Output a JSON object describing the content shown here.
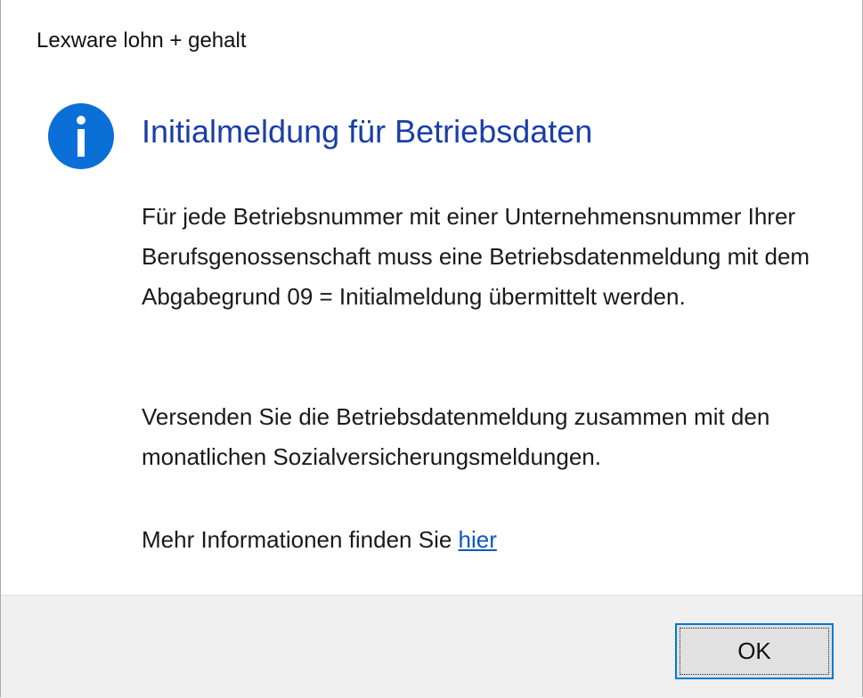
{
  "window": {
    "title": "Lexware lohn + gehalt"
  },
  "dialog": {
    "icon": "info-icon",
    "icon_color": "#0a6fd6",
    "heading": "Initialmeldung für Betriebsdaten",
    "heading_color": "#1a3ea8",
    "paragraph_1": "Für jede Betriebsnummer mit einer Unternehmensnummer Ihrer Berufsgenossenschaft muss eine Betriebsdatenmeldung mit dem Abgabegrund 09 = Initialmeldung übermittelt werden.",
    "paragraph_2": "Versenden Sie die Betriebsdatenmeldung zusammen mit den monatlichen Sozialversicherungsmeldungen.",
    "more_info_text": "Mehr Informationen finden Sie ",
    "more_info_link": "hier",
    "link_color": "#0b57c4"
  },
  "footer": {
    "ok_label": "OK",
    "button_focus_color": "#0078d7"
  }
}
